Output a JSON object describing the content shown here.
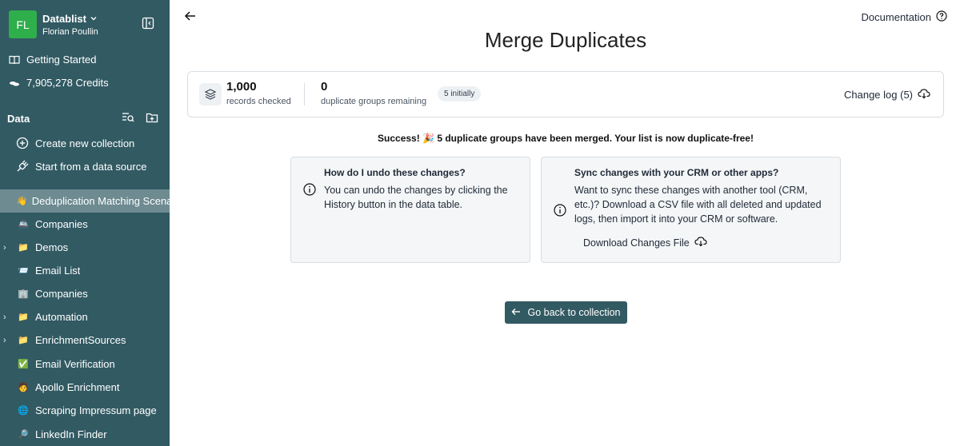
{
  "sidebar": {
    "workspace": {
      "initials": "FL",
      "name": "Datablist",
      "user": "Florian Poullin"
    },
    "top_items": [
      {
        "label": "Getting Started",
        "icon": "book-icon"
      },
      {
        "label": "7,905,278 Credits",
        "icon": "coins-icon"
      }
    ],
    "data_heading": "Data",
    "actions": [
      {
        "label": "Create new collection",
        "icon": "plus-circle-icon"
      },
      {
        "label": "Start from a data source",
        "icon": "plug-icon"
      }
    ],
    "collections": [
      {
        "label": "Deduplication Matching Scenarios",
        "emoji": "👋",
        "expandable": false,
        "active": true
      },
      {
        "label": "Companies",
        "emoji": "🚢",
        "expandable": false,
        "active": false
      },
      {
        "label": "Demos",
        "emoji": "📁",
        "expandable": true,
        "active": false
      },
      {
        "label": "Email List",
        "emoji": "📨",
        "expandable": false,
        "active": false
      },
      {
        "label": "Companies",
        "emoji": "🏢",
        "expandable": false,
        "active": false
      },
      {
        "label": "Automation",
        "emoji": "📁",
        "expandable": true,
        "active": false
      },
      {
        "label": "EnrichmentSources",
        "emoji": "📁",
        "expandable": true,
        "active": false
      },
      {
        "label": "Email Verification",
        "emoji": "✅",
        "expandable": false,
        "active": false
      },
      {
        "label": "Apollo Enrichment",
        "emoji": "🧑",
        "expandable": false,
        "active": false
      },
      {
        "label": "Scraping Impressum page",
        "emoji": "🌐",
        "expandable": false,
        "active": false
      },
      {
        "label": "LinkedIn Finder",
        "emoji": "🔎",
        "expandable": false,
        "active": false
      }
    ],
    "colors": {
      "background": "#325a63",
      "active_row": "#6d8b91",
      "avatar": "#2fae4c"
    }
  },
  "header": {
    "documentation_label": "Documentation"
  },
  "main": {
    "title": "Merge Duplicates",
    "stats": {
      "records_value": "1,000",
      "records_caption": "records checked",
      "groups_value": "0",
      "groups_caption": "duplicate groups remaining",
      "initial_badge": "5 initially",
      "changelog_label": "Change log (5)"
    },
    "success_message": "Success! 🎉 5 duplicate groups have been merged. Your list is now duplicate-free!",
    "undo_card": {
      "title": "How do I undo these changes?",
      "body": "You can undo the changes by clicking the History button in the data table."
    },
    "sync_card": {
      "title": "Sync changes with your CRM or other apps?",
      "body": "Want to sync these changes with another tool (CRM, etc.)? Download a CSV file with all deleted and updated logs, then import it into your CRM or software.",
      "download_label": "Download Changes File"
    },
    "go_back_label": "Go back to collection"
  }
}
